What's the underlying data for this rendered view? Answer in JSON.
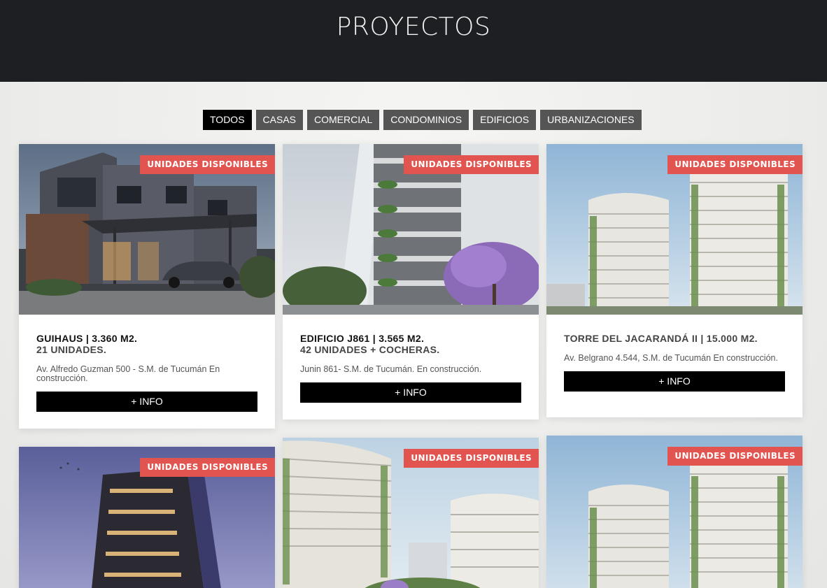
{
  "page": {
    "title": "PROYECTOS"
  },
  "filters": [
    "TODOS",
    "CASAS",
    "COMERCIAL",
    "CONDOMINIOS",
    "EDIFICIOS",
    "URBANIZACIONES"
  ],
  "badge_text": "UNIDADES DISPONIBLES",
  "colors": {
    "header_bg": "#1e1f23",
    "badge": "#e2544f",
    "button": "#000000",
    "filter_inactive": "#555555",
    "filter_active": "#000000"
  },
  "cards": [
    {
      "title": "GUIHAUS | 3.360 M2.",
      "subtitle": "21 UNIDADES.",
      "address": "Av. Alfredo Guzman 500 - S.M. de Tucumán En construcción.",
      "button": "+ INFO"
    },
    {
      "title": "EDIFICIO J861 | 3.565 M2.",
      "subtitle": "42 UNIDADES + COCHERAS.",
      "address": "Junin 861- S.M. de Tucumán. En construcción.",
      "button": "+ INFO"
    },
    {
      "title": "TORRE DEL JACARANDÁ II | 15.000 M2.",
      "subtitle": "",
      "address": "Av. Belgrano 4.544, S.M. de Tucumán En construcción.",
      "button": "+ INFO"
    },
    {
      "title": "",
      "subtitle": "",
      "address": "",
      "button": ""
    },
    {
      "title": "",
      "subtitle": "",
      "address": "",
      "button": ""
    },
    {
      "title": "",
      "subtitle": "",
      "address": "",
      "button": ""
    }
  ]
}
